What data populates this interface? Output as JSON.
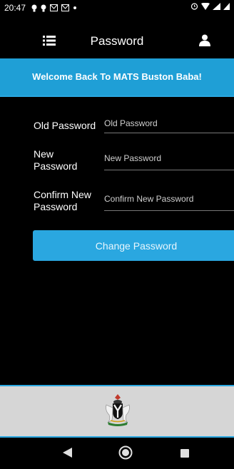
{
  "status_bar": {
    "time": "20:47"
  },
  "header": {
    "title": "Password"
  },
  "banner": {
    "text": "Welcome Back To MATS Buston Baba!"
  },
  "form": {
    "old_password": {
      "label": "Old Password",
      "placeholder": "Old Password",
      "value": ""
    },
    "new_password": {
      "label": "New Password",
      "placeholder": "New Password",
      "value": ""
    },
    "confirm_password": {
      "label": "Confirm New Password",
      "placeholder": "Confirm New Password",
      "value": ""
    }
  },
  "actions": {
    "change_password_label": "Change Password"
  },
  "colors": {
    "accent": "#2aa7e0",
    "banner": "#1f9fd6",
    "background": "#000000",
    "footer": "#d6d6d6"
  },
  "icons": {
    "menu": "list-menu-icon",
    "user": "user-profile-icon",
    "footer": "coat-of-arms-emblem",
    "nav_back": "back-triangle-icon",
    "nav_home": "home-circle-icon",
    "nav_recents": "recents-square-icon"
  }
}
